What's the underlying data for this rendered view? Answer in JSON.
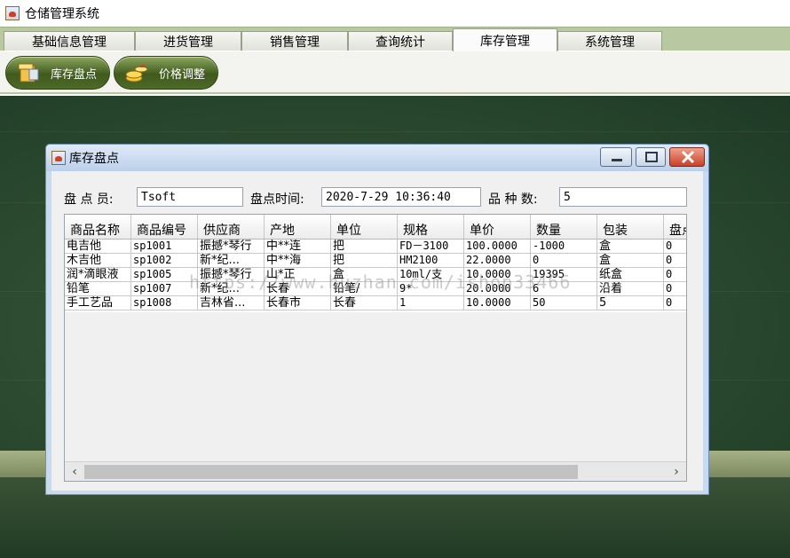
{
  "app": {
    "title": "仓储管理系统",
    "icon": "java-cup-icon"
  },
  "tabs": [
    {
      "label": "基础信息管理",
      "active": false
    },
    {
      "label": "进货管理",
      "active": false
    },
    {
      "label": "销售管理",
      "active": false
    },
    {
      "label": "查询统计",
      "active": false
    },
    {
      "label": "库存管理",
      "active": true
    },
    {
      "label": "系统管理",
      "active": false
    }
  ],
  "toolbar": {
    "buttons": [
      {
        "label": "库存盘点",
        "icon": "inventory-box-icon"
      },
      {
        "label": "价格调整",
        "icon": "price-coins-icon"
      }
    ]
  },
  "dialog": {
    "title": "库存盘点",
    "controls": [
      "minimize",
      "maximize",
      "close"
    ],
    "fields": {
      "checker_label": "盘 点 员:",
      "checker_value": "Tsoft",
      "time_label": "盘点时间:",
      "time_value": "2020-7-29 10:36:40",
      "count_label": "品 种 数:",
      "count_value": "5"
    },
    "table": {
      "headers": [
        "商品名称",
        "商品编号",
        "供应商",
        "产地",
        "单位",
        "规格",
        "单价",
        "数量",
        "包装",
        "盘点"
      ],
      "rows": [
        [
          "电吉他",
          "sp1001",
          "振撼*琴行",
          "中**连",
          "把",
          "FD－3100",
          "100.0000",
          "-1000",
          "盒",
          "0"
        ],
        [
          "木吉他",
          "sp1002",
          "新*纪...",
          "中**海",
          "把",
          "HM2100",
          "22.0000",
          "0",
          "盒",
          "0"
        ],
        [
          "润*滴眼液",
          "sp1005",
          "振撼*琴行",
          "山*正",
          "盒",
          "10ml/支",
          "10.0000",
          "19395",
          "纸盒",
          "0"
        ],
        [
          "铅笔",
          "sp1007",
          "新*纪...",
          "长春",
          "铅笔/",
          "9*",
          "20.0000",
          "6",
          "沿着",
          "0"
        ],
        [
          "手工艺品",
          "sp1008",
          "吉林省...",
          "长春市",
          "长春",
          "1",
          "10.0000",
          "50",
          "5",
          "0"
        ]
      ]
    }
  },
  "watermark": "https://www.huzhan.com/ishop33466"
}
